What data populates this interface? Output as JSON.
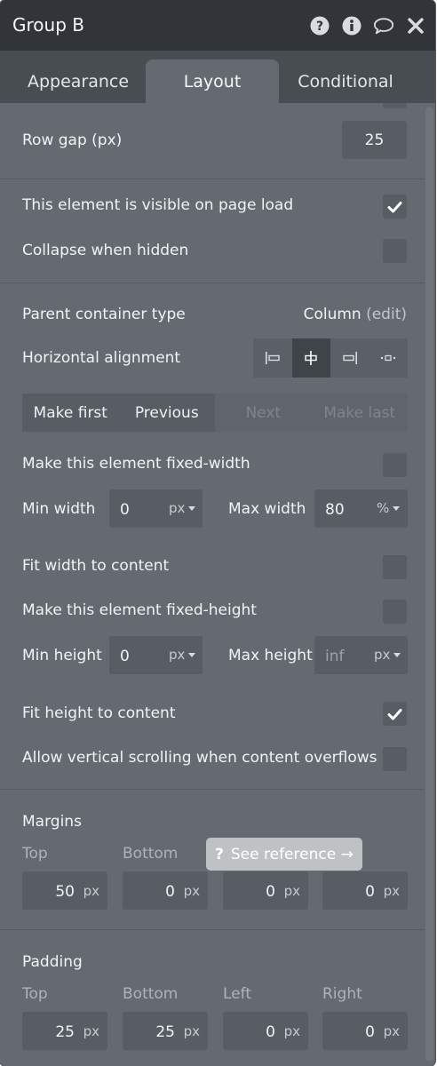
{
  "window": {
    "title": "Group B"
  },
  "title_icons": [
    "help-icon",
    "info-icon",
    "comment-icon",
    "close-icon"
  ],
  "tabs": [
    {
      "label": "Appearance",
      "active": false
    },
    {
      "label": "Layout",
      "active": true
    },
    {
      "label": "Conditional",
      "active": false
    }
  ],
  "row_gap": {
    "label": "Row gap (px)",
    "value": "25"
  },
  "visibility": {
    "visible_label": "This element is visible on page load",
    "visible_checked": true,
    "collapse_label": "Collapse when hidden",
    "collapse_checked": false
  },
  "container": {
    "type_label": "Parent container type",
    "type_value": "Column",
    "edit_label": "(edit)",
    "halign_label": "Horizontal alignment",
    "halign_options": [
      "align-left-icon",
      "align-center-icon",
      "align-right-icon",
      "align-distribute-icon"
    ],
    "halign_selected": "align-center-icon"
  },
  "order": {
    "make_first": "Make first",
    "previous": "Previous",
    "next": "Next",
    "make_last": "Make last"
  },
  "width": {
    "fixed_label": "Make this element fixed-width",
    "fixed_checked": false,
    "min_label": "Min width",
    "min_value": "0",
    "min_unit": "px",
    "max_label": "Max width",
    "max_value": "80",
    "max_unit": "%",
    "fit_label": "Fit width to content",
    "fit_checked": false
  },
  "height": {
    "fixed_label": "Make this element fixed-height",
    "fixed_checked": false,
    "min_label": "Min height",
    "min_value": "0",
    "min_unit": "px",
    "max_label": "Max height",
    "max_placeholder": "inf",
    "max_unit": "px",
    "fit_label": "Fit height to content",
    "fit_checked": true,
    "scroll_label": "Allow vertical scrolling when content overflows",
    "scroll_checked": false
  },
  "margins": {
    "title": "Margins",
    "top_label": "Top",
    "bottom_label": "Bottom",
    "top": "50",
    "bottom": "0",
    "left": "0",
    "right": "0",
    "unit": "px"
  },
  "tooltip": {
    "icon": "?",
    "text": "See reference →"
  },
  "padding": {
    "title": "Padding",
    "top_label": "Top",
    "bottom_label": "Bottom",
    "left_label": "Left",
    "right_label": "Right",
    "top": "25",
    "bottom": "25",
    "left": "0",
    "right": "0",
    "unit": "px"
  },
  "colors": {
    "panel": "#646a6f",
    "titlebar": "#313539",
    "tabbar": "#484d52",
    "field": "#575d62"
  }
}
